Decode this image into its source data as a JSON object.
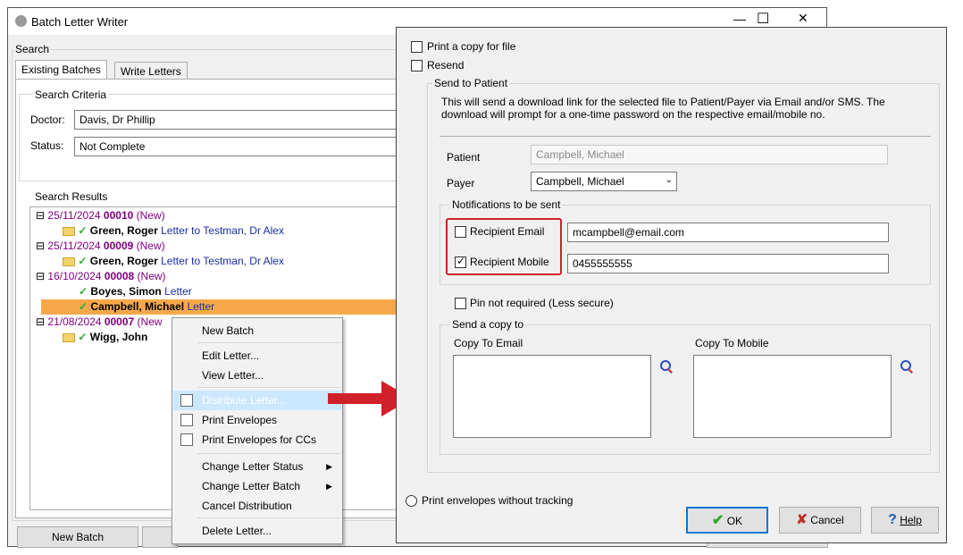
{
  "window": {
    "title": "Batch Letter Writer",
    "controls": {
      "minimize": "—",
      "maximize": "☐",
      "close": "✕"
    }
  },
  "search": {
    "group_label": "Search",
    "tabs": [
      {
        "label": "Existing Batches"
      },
      {
        "label": "Write Letters"
      }
    ],
    "criteria_label": "Search Criteria",
    "doctor_label": "Doctor:",
    "doctor_value": "Davis, Dr Phillip",
    "status_label": "Status:",
    "status_value": "Not Complete"
  },
  "results": {
    "label": "Search Results",
    "batches": [
      {
        "toggle": "⊟",
        "date": "25/11/2024",
        "number": "00010",
        "state": "(New)",
        "letters": [
          {
            "name": "Green, Roger",
            "desc": "Letter to Testman, Dr Alex"
          }
        ]
      },
      {
        "toggle": "⊟",
        "date": "25/11/2024",
        "number": "00009",
        "state": "(New)",
        "letters": [
          {
            "name": "Green, Roger",
            "desc": "Letter to Testman, Dr Alex"
          }
        ]
      },
      {
        "toggle": "⊟",
        "date": "16/10/2024",
        "number": "00008",
        "state": "(New)",
        "letters": [
          {
            "name": "Boyes, Simon",
            "desc": "Letter"
          },
          {
            "name": "Campbell, Michael",
            "desc": "Letter"
          }
        ]
      },
      {
        "toggle": "⊟",
        "date": "21/08/2024",
        "number": "00007",
        "state": "(New",
        "letters": [
          {
            "name": "Wigg, John",
            "desc": ""
          }
        ]
      }
    ]
  },
  "bottom_buttons": {
    "new_batch": "New Batch"
  },
  "context_menu": {
    "items": [
      {
        "label": "New Batch"
      },
      {
        "label": "Edit Letter..."
      },
      {
        "label": "View Letter..."
      },
      {
        "label": "Distribute Letter..."
      },
      {
        "label": "Print Envelopes"
      },
      {
        "label": "Print Envelopes for CCs"
      },
      {
        "label": "Change Letter Status"
      },
      {
        "label": "Change Letter Batch"
      },
      {
        "label": "Cancel Distribution"
      },
      {
        "label": "Delete Letter..."
      }
    ]
  },
  "dialog": {
    "print_copy_label": "Print a copy for file",
    "resend_label": "Resend",
    "send_to_patient_label": "Send to Patient",
    "send_description": "This will send a download link for the selected file to Patient/Payer via Email and/or SMS. The download will prompt for a one-time password on the respective email/mobile no.",
    "patient_label": "Patient",
    "patient_value": "Campbell, Michael",
    "payer_label": "Payer",
    "payer_value": "Campbell, Michael",
    "notifications_label": "Notifications to be sent",
    "recipient_email_label": "Recipient Email",
    "recipient_email_value": "mcampbell@email.com",
    "recipient_email_checked": false,
    "recipient_mobile_label": "Recipient Mobile",
    "recipient_mobile_value": "0455555555",
    "recipient_mobile_checked": true,
    "pin_label": "Pin not required (Less secure)",
    "send_copy_label": "Send a copy to",
    "copy_email_label": "Copy To Email",
    "copy_mobile_label": "Copy To Mobile",
    "print_envelopes_label": "Print envelopes without tracking",
    "ok_label": "OK",
    "cancel_label": "Cancel",
    "help_label": "Help"
  },
  "colors": {
    "accent_red": "#d0202a",
    "selection": "#f7a84a",
    "batch_purple": "#800080",
    "link_blue": "#1a2da8"
  }
}
